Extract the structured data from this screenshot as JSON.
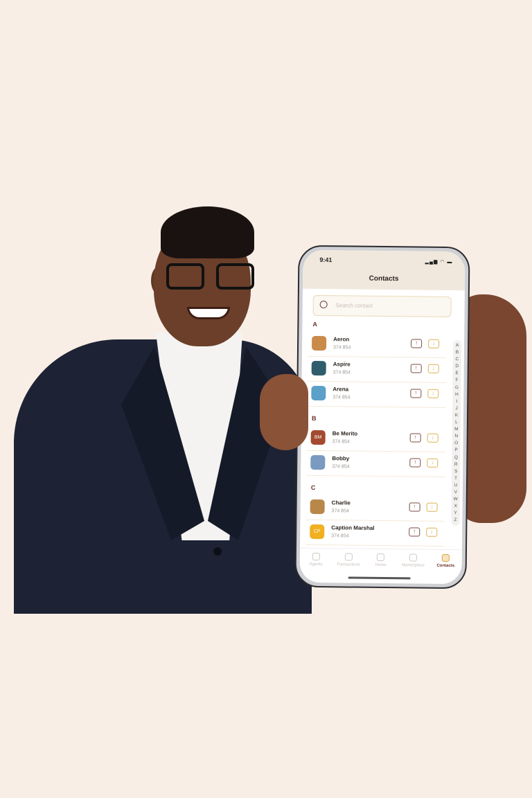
{
  "status_bar": {
    "time": "9:41",
    "icons": "signal wifi battery"
  },
  "header": {
    "title": "Contacts"
  },
  "search": {
    "placeholder": "Search contact"
  },
  "sections": [
    {
      "letter": "A",
      "contacts": [
        {
          "name": "Aeron",
          "phone": "374 854",
          "avatar": "photo"
        },
        {
          "name": "Aspire",
          "phone": "374 854",
          "avatar": "photo"
        },
        {
          "name": "Arena",
          "phone": "374 854",
          "avatar": "photo"
        }
      ]
    },
    {
      "letter": "B",
      "contacts": [
        {
          "name": "Be Merito",
          "phone": "374 854",
          "avatar": "BM"
        },
        {
          "name": "Bobby",
          "phone": "374 854",
          "avatar": "photo"
        }
      ]
    },
    {
      "letter": "C",
      "contacts": [
        {
          "name": "Charlie",
          "phone": "374 854",
          "avatar": "photo"
        },
        {
          "name": "Caption Marshal",
          "phone": "374 854",
          "avatar": "CP"
        }
      ]
    }
  ],
  "index": "A B C D E F G H I J K L M N O P Q R S T U V W X Y Z",
  "tabs": [
    {
      "label": "Agents"
    },
    {
      "label": "Transactions"
    },
    {
      "label": "Home"
    },
    {
      "label": "Marketplace"
    },
    {
      "label": "Contacts",
      "active": true
    }
  ],
  "colors": {
    "background": "#f8eee5",
    "accent": "#d9a441",
    "brand": "#6a2f24",
    "header": "#f0e8dc"
  }
}
